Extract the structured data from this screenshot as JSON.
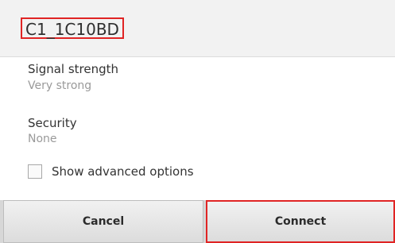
{
  "dialog": {
    "title": "C1_1C10BD",
    "fields": [
      {
        "label": "Signal strength",
        "value": "Very strong"
      },
      {
        "label": "Security",
        "value": "None"
      }
    ],
    "advanced_options_label": "Show advanced options",
    "advanced_options_checked": false,
    "buttons": {
      "cancel_label": "Cancel",
      "connect_label": "Connect"
    }
  },
  "colors": {
    "highlight": "#e02424",
    "title_bar_bg": "#f2f2f2",
    "value_text": "#9a9a9a"
  }
}
